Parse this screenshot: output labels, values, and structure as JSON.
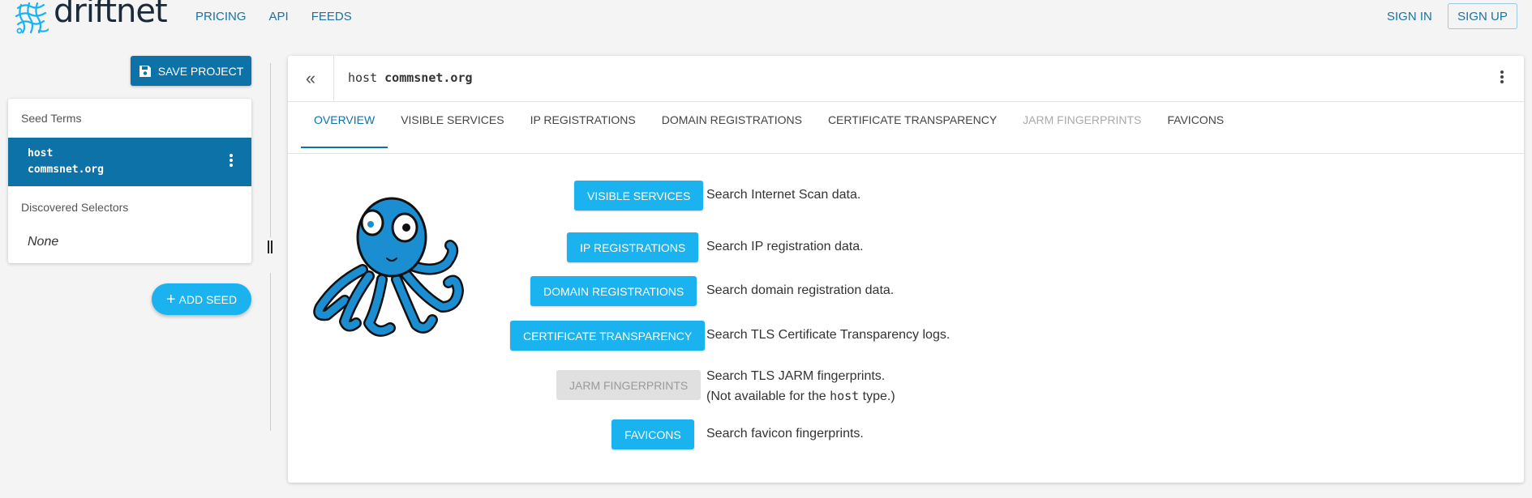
{
  "header": {
    "logo_text": "driftnet",
    "nav": [
      "PRICING",
      "API",
      "FEEDS"
    ],
    "sign_in": "SIGN IN",
    "sign_up": "SIGN UP"
  },
  "left": {
    "save_label": "SAVE PROJECT",
    "seed_terms_label": "Seed Terms",
    "seed_type": "host",
    "seed_value": "commsnet.org",
    "discovered_label": "Discovered Selectors",
    "discovered_none": "None",
    "add_seed_label": "ADD SEED"
  },
  "main": {
    "query_type": "host",
    "query_value": "commsnet.org",
    "tabs": [
      {
        "label": "OVERVIEW"
      },
      {
        "label": "VISIBLE SERVICES"
      },
      {
        "label": "IP REGISTRATIONS"
      },
      {
        "label": "DOMAIN REGISTRATIONS"
      },
      {
        "label": "CERTIFICATE TRANSPARENCY"
      },
      {
        "label": "JARM FINGERPRINTS"
      },
      {
        "label": "FAVICONS"
      }
    ],
    "active_tab": "OVERVIEW",
    "disabled_tab": "JARM FINGERPRINTS",
    "rows": [
      {
        "button": "VISIBLE SERVICES",
        "desc": "Search Internet Scan data."
      },
      {
        "button": "IP REGISTRATIONS",
        "desc": "Search IP registration data."
      },
      {
        "button": "DOMAIN REGISTRATIONS",
        "desc": "Search domain registration data."
      },
      {
        "button": "CERTIFICATE TRANSPARENCY",
        "desc": "Search TLS Certificate Transparency logs."
      },
      {
        "button": "JARM FINGERPRINTS",
        "desc": "Search TLS JARM fingerprints.",
        "note_prefix": "(Not available for the ",
        "note_code": "host",
        "note_suffix": " type.)"
      },
      {
        "button": "FAVICONS",
        "desc": "Search favicon fingerprints."
      }
    ]
  },
  "colors": {
    "primary": "#0c72a8",
    "accent": "#1ab3ef",
    "disabled": "#e0e0e0"
  }
}
